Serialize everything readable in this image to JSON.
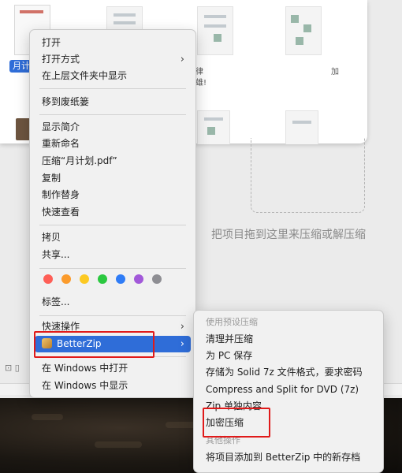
{
  "finder": {
    "selected_file_label": "月计",
    "file_labels": [
      "律",
      "雄!",
      "加"
    ]
  },
  "dropzone": {
    "text": "把项目拖到这里来压缩或解压缩"
  },
  "context_menu": {
    "items": [
      {
        "label": "打开"
      },
      {
        "label": "打开方式",
        "submenu": true
      },
      {
        "label": "在上层文件夹中显示"
      },
      {
        "label": "移到废纸篓"
      },
      {
        "label": "显示简介"
      },
      {
        "label": "重新命名"
      },
      {
        "label": "压缩“月计划.pdf”"
      },
      {
        "label": "复制"
      },
      {
        "label": "制作替身"
      },
      {
        "label": "快速查看"
      },
      {
        "label": "拷贝"
      },
      {
        "label": "共享..."
      },
      {
        "label": "标签..."
      },
      {
        "label": "快速操作",
        "submenu": true
      },
      {
        "label": "BetterZip",
        "submenu": true,
        "highlighted": true
      },
      {
        "label": "在 Windows 中打开"
      },
      {
        "label": "在 Windows 中显示"
      }
    ],
    "tag_colors": [
      "#fe5f57",
      "#fb9b2c",
      "#fcc922",
      "#2bc840",
      "#2f7cf6",
      "#a259d9",
      "#8e8e93"
    ]
  },
  "submenu": {
    "section1_header": "使用预设压缩",
    "items": [
      {
        "label": "清理并压缩"
      },
      {
        "label": "为 PC 保存"
      },
      {
        "label": "存储为 Solid 7z 文件格式，要求密码"
      },
      {
        "label": "Compress and Split for DVD (7z)"
      },
      {
        "label": "Zip 单独内容"
      },
      {
        "label": "加密压缩"
      }
    ],
    "section2_header": "其他操作",
    "other_items": [
      {
        "label": "将项目添加到 BetterZip 中的新存档"
      }
    ]
  },
  "colors": {
    "highlight": "#2f6dd8",
    "annotation_red": "#e01a1a"
  }
}
